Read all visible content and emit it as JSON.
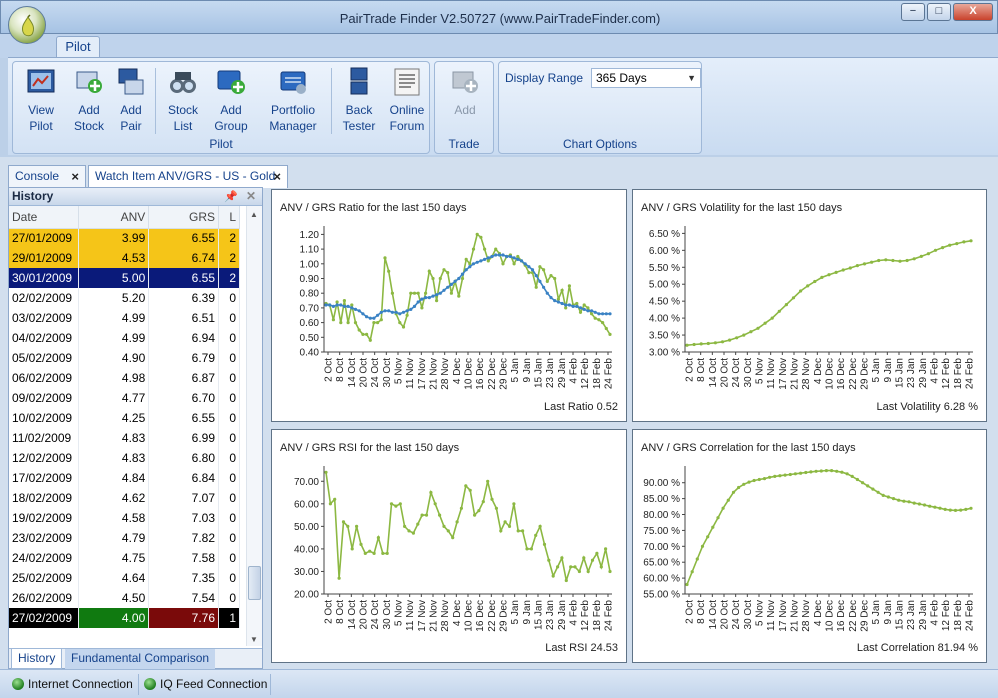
{
  "window": {
    "title": "PairTrade Finder V2.50727 (www.PairTradeFinder.com)",
    "minimize": "−",
    "maximize": "□",
    "close": "X"
  },
  "ribbon": {
    "tab": "Pilot",
    "groups": {
      "pilot": "Pilot",
      "trade": "Trade",
      "chart_options": "Chart Options"
    },
    "buttons": {
      "view_pilot": [
        "View",
        "Pilot"
      ],
      "add_stock": [
        "Add",
        "Stock"
      ],
      "add_pair": [
        "Add",
        "Pair"
      ],
      "stock_list": [
        "Stock",
        "List"
      ],
      "add_group": [
        "Add",
        "Group"
      ],
      "portfolio_manager": [
        "Portfolio",
        "Manager"
      ],
      "back_tester": [
        "Back",
        "Tester"
      ],
      "online_forum": [
        "Online",
        "Forum"
      ],
      "add_trade": [
        "Add",
        ""
      ]
    },
    "display_range_label": "Display Range",
    "display_range_value": "365 Days"
  },
  "doc_tabs": [
    {
      "label": "Console",
      "close": "×"
    },
    {
      "label": "Watch Item ANV/GRS - US - Gold",
      "close": "×"
    }
  ],
  "history": {
    "title": "History",
    "columns": [
      "Date",
      "ANV",
      "GRS",
      "L"
    ],
    "rows": [
      {
        "date": "27/01/2009",
        "anv": "3.99",
        "grs": "6.55",
        "l": "2",
        "style": "yellow"
      },
      {
        "date": "29/01/2009",
        "anv": "4.53",
        "grs": "6.74",
        "l": "2",
        "style": "yellow"
      },
      {
        "date": "30/01/2009",
        "anv": "5.00",
        "grs": "6.55",
        "l": "2",
        "style": "navy"
      },
      {
        "date": "02/02/2009",
        "anv": "5.20",
        "grs": "6.39",
        "l": "0",
        "style": ""
      },
      {
        "date": "03/02/2009",
        "anv": "4.99",
        "grs": "6.51",
        "l": "0",
        "style": ""
      },
      {
        "date": "04/02/2009",
        "anv": "4.99",
        "grs": "6.94",
        "l": "0",
        "style": ""
      },
      {
        "date": "05/02/2009",
        "anv": "4.90",
        "grs": "6.79",
        "l": "0",
        "style": ""
      },
      {
        "date": "06/02/2009",
        "anv": "4.98",
        "grs": "6.87",
        "l": "0",
        "style": ""
      },
      {
        "date": "09/02/2009",
        "anv": "4.77",
        "grs": "6.70",
        "l": "0",
        "style": ""
      },
      {
        "date": "10/02/2009",
        "anv": "4.25",
        "grs": "6.55",
        "l": "0",
        "style": ""
      },
      {
        "date": "11/02/2009",
        "anv": "4.83",
        "grs": "6.99",
        "l": "0",
        "style": ""
      },
      {
        "date": "12/02/2009",
        "anv": "4.83",
        "grs": "6.80",
        "l": "0",
        "style": ""
      },
      {
        "date": "17/02/2009",
        "anv": "4.84",
        "grs": "6.84",
        "l": "0",
        "style": ""
      },
      {
        "date": "18/02/2009",
        "anv": "4.62",
        "grs": "7.07",
        "l": "0",
        "style": ""
      },
      {
        "date": "19/02/2009",
        "anv": "4.58",
        "grs": "7.03",
        "l": "0",
        "style": ""
      },
      {
        "date": "23/02/2009",
        "anv": "4.79",
        "grs": "7.82",
        "l": "0",
        "style": ""
      },
      {
        "date": "24/02/2009",
        "anv": "4.75",
        "grs": "7.58",
        "l": "0",
        "style": ""
      },
      {
        "date": "25/02/2009",
        "anv": "4.64",
        "grs": "7.35",
        "l": "0",
        "style": ""
      },
      {
        "date": "26/02/2009",
        "anv": "4.50",
        "grs": "7.54",
        "l": "0",
        "style": ""
      },
      {
        "date": "27/02/2009",
        "anv": "4.00",
        "grs": "7.76",
        "l": "1",
        "style": "last"
      }
    ],
    "bottom_tabs": [
      "History",
      "Fundamental Comparison"
    ]
  },
  "colors": {
    "green": "#8cb842",
    "blue": "#3a82c4",
    "yellow": "#f5c518",
    "navy": "#0a1a7a",
    "dark_green": "#107a10",
    "dark_red": "#7a0a0a"
  },
  "chart_data": [
    {
      "type": "line",
      "title": "ANV / GRS Ratio  for the last 150 days",
      "footer": "Last Ratio 0.52",
      "x_ticks": [
        "2 Oct",
        "8 Oct",
        "14 Oct",
        "20 Oct",
        "24 Oct",
        "30 Oct",
        "5 Nov",
        "11 Nov",
        "17 Nov",
        "21 Nov",
        "28 Nov",
        "4 Dec",
        "10 Dec",
        "16 Dec",
        "22 Dec",
        "29 Dec",
        "5 Jan",
        "9 Jan",
        "15 Jan",
        "23 Jan",
        "29 Jan",
        "4 Feb",
        "12 Feb",
        "18 Feb",
        "24 Feb"
      ],
      "y_ticks": [
        "0.40",
        "0.50",
        "0.60",
        "0.70",
        "0.80",
        "0.90",
        "1.00",
        "1.10",
        "1.20"
      ],
      "ylim": [
        0.4,
        1.23
      ],
      "series": [
        {
          "color": "#8cb842",
          "values": [
            0.73,
            0.72,
            0.62,
            0.74,
            0.6,
            0.75,
            0.6,
            0.72,
            0.6,
            0.55,
            0.52,
            0.52,
            0.48,
            0.6,
            0.6,
            0.62,
            1.04,
            0.95,
            0.8,
            0.66,
            0.6,
            0.57,
            0.65,
            0.8,
            0.8,
            0.8,
            0.7,
            0.8,
            0.95,
            0.9,
            0.75,
            0.9,
            0.96,
            0.94,
            0.8,
            0.88,
            0.78,
            0.9,
            1.03,
            1.0,
            1.1,
            1.2,
            1.18,
            1.1,
            1.02,
            1.05,
            1.1,
            1.07,
            1.0,
            1.05,
            1.06,
            1.0,
            1.05,
            1.02,
            0.99,
            0.94,
            0.94,
            0.84,
            0.98,
            0.96,
            0.88,
            0.92,
            0.9,
            0.76,
            0.82,
            0.7,
            0.85,
            0.72,
            0.73,
            0.67,
            0.72,
            0.7,
            0.66,
            0.63,
            0.62,
            0.6,
            0.56,
            0.52
          ]
        },
        {
          "color": "#3a82c4",
          "values": [
            0.72,
            0.72,
            0.71,
            0.72,
            0.72,
            0.71,
            0.71,
            0.7,
            0.69,
            0.68,
            0.66,
            0.64,
            0.63,
            0.63,
            0.65,
            0.67,
            0.68,
            0.68,
            0.67,
            0.67,
            0.66,
            0.67,
            0.68,
            0.69,
            0.71,
            0.74,
            0.76,
            0.77,
            0.77,
            0.78,
            0.79,
            0.8,
            0.82,
            0.84,
            0.86,
            0.88,
            0.9,
            0.93,
            0.96,
            0.98,
            1.0,
            1.01,
            1.02,
            1.03,
            1.04,
            1.05,
            1.06,
            1.06,
            1.06,
            1.05,
            1.05,
            1.04,
            1.03,
            1.02,
            1.0,
            0.98,
            0.96,
            0.92,
            0.88,
            0.84,
            0.8,
            0.77,
            0.75,
            0.74,
            0.73,
            0.72,
            0.72,
            0.71,
            0.71,
            0.7,
            0.69,
            0.68,
            0.68,
            0.67,
            0.66,
            0.66,
            0.66,
            0.66
          ]
        }
      ]
    },
    {
      "type": "line",
      "title": "ANV / GRS Volatility  for the last 150 days",
      "footer": "Last Volatility 6.28 %",
      "x_ticks": [
        "2 Oct",
        "8 Oct",
        "14 Oct",
        "20 Oct",
        "24 Oct",
        "30 Oct",
        "5 Nov",
        "11 Nov",
        "17 Nov",
        "21 Nov",
        "28 Nov",
        "4 Dec",
        "10 Dec",
        "16 Dec",
        "22 Dec",
        "29 Dec",
        "5 Jan",
        "9 Jan",
        "15 Jan",
        "23 Jan",
        "29 Jan",
        "4 Feb",
        "12 Feb",
        "18 Feb",
        "24 Feb"
      ],
      "y_ticks": [
        "3.00 %",
        "3.50 %",
        "4.00 %",
        "4.50 %",
        "5.00 %",
        "5.50 %",
        "6.00 %",
        "6.50 %"
      ],
      "ylim": [
        3.0,
        6.6
      ],
      "series": [
        {
          "color": "#8cb842",
          "values": [
            3.2,
            3.22,
            3.24,
            3.25,
            3.27,
            3.3,
            3.35,
            3.42,
            3.5,
            3.6,
            3.7,
            3.85,
            4.0,
            4.2,
            4.4,
            4.6,
            4.8,
            4.95,
            5.08,
            5.2,
            5.28,
            5.35,
            5.42,
            5.48,
            5.55,
            5.6,
            5.65,
            5.7,
            5.72,
            5.7,
            5.68,
            5.7,
            5.75,
            5.82,
            5.9,
            6.0,
            6.08,
            6.15,
            6.2,
            6.25,
            6.28
          ]
        }
      ]
    },
    {
      "type": "line",
      "title": "ANV / GRS RSI  for the last 150 days",
      "footer": "Last RSI 24.53",
      "x_ticks": [
        "2 Oct",
        "8 Oct",
        "14 Oct",
        "20 Oct",
        "24 Oct",
        "30 Oct",
        "5 Nov",
        "11 Nov",
        "17 Nov",
        "21 Nov",
        "28 Nov",
        "4 Dec",
        "10 Dec",
        "16 Dec",
        "22 Dec",
        "29 Dec",
        "5 Jan",
        "9 Jan",
        "15 Jan",
        "23 Jan",
        "29 Jan",
        "4 Feb",
        "12 Feb",
        "18 Feb",
        "24 Feb"
      ],
      "y_ticks": [
        "20.00",
        "30.00",
        "40.00",
        "50.00",
        "60.00",
        "70.00"
      ],
      "ylim": [
        20,
        75
      ],
      "series": [
        {
          "color": "#8cb842",
          "values": [
            74,
            60,
            62,
            27,
            52,
            50,
            40,
            50,
            42,
            38,
            39,
            38,
            45,
            38,
            38,
            60,
            59,
            60,
            50,
            48,
            47,
            51,
            55,
            55,
            65,
            60,
            55,
            50,
            48,
            45,
            52,
            58,
            68,
            66,
            55,
            57,
            61,
            70,
            62,
            58,
            48,
            52,
            50,
            60,
            48,
            48,
            40,
            40,
            46,
            50,
            42,
            35,
            28,
            32,
            36,
            26,
            32,
            32,
            30,
            36,
            30,
            35,
            38,
            32,
            40,
            30
          ]
        }
      ]
    },
    {
      "type": "line",
      "title": "ANV / GRS Correlation  for the last 150 days",
      "footer": "Last Correlation 81.94 %",
      "x_ticks": [
        "2 Oct",
        "8 Oct",
        "14 Oct",
        "20 Oct",
        "24 Oct",
        "30 Oct",
        "5 Nov",
        "11 Nov",
        "17 Nov",
        "21 Nov",
        "28 Nov",
        "4 Dec",
        "10 Dec",
        "16 Dec",
        "22 Dec",
        "29 Dec",
        "5 Jan",
        "9 Jan",
        "15 Jan",
        "23 Jan",
        "29 Jan",
        "4 Feb",
        "12 Feb",
        "18 Feb",
        "24 Feb"
      ],
      "y_ticks": [
        "55.00 %",
        "60.00 %",
        "65.00 %",
        "70.00 %",
        "75.00 %",
        "80.00 %",
        "85.00 %",
        "90.00 %"
      ],
      "ylim": [
        55,
        94
      ],
      "series": [
        {
          "color": "#8cb842",
          "values": [
            58,
            62,
            66,
            70,
            73,
            76,
            79,
            82,
            84.5,
            87,
            88.5,
            89.5,
            90.2,
            90.7,
            91,
            91.3,
            91.7,
            92,
            92.2,
            92.4,
            92.6,
            92.8,
            93.0,
            93.2,
            93.4,
            93.6,
            93.7,
            93.8,
            93.8,
            93.6,
            93.3,
            92.8,
            92,
            91,
            90,
            89,
            88,
            87,
            86,
            85.5,
            85,
            84.5,
            84.2,
            84,
            83.6,
            83.3,
            83,
            82.6,
            82.3,
            82,
            81.6,
            81.4,
            81.3,
            81.4,
            81.6,
            81.94
          ]
        }
      ]
    }
  ]
}
